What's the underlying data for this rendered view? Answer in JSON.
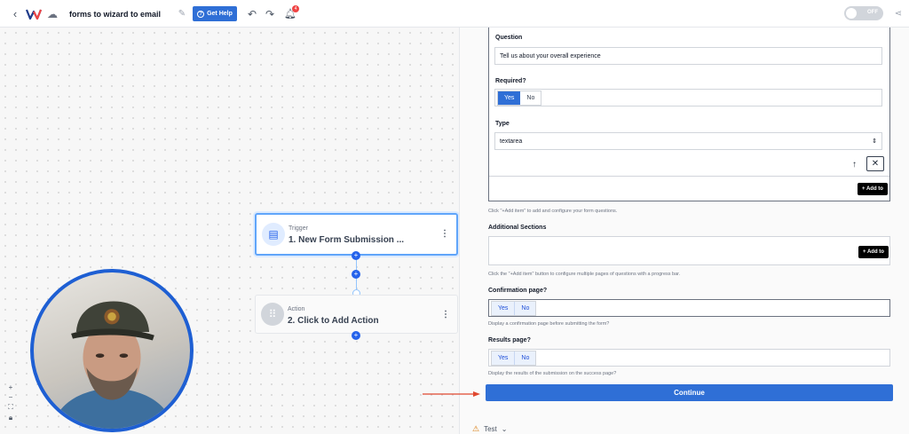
{
  "topbar": {
    "back_icon": "chevron-left-icon",
    "title": "forms to wizard to email",
    "help_label": "Get Help",
    "notification_count": "4",
    "toggle_label": "OFF"
  },
  "canvas": {
    "trigger": {
      "sub": "Trigger",
      "title": "1. New Form Submission ..."
    },
    "action": {
      "sub": "Action",
      "title": "2. Click to Add Action"
    }
  },
  "panel": {
    "question_label": "Question",
    "question_value": "Tell us about your overall experience",
    "required_label": "Required?",
    "yes": "Yes",
    "no": "No",
    "type_label": "Type",
    "type_value": "textarea",
    "add_item_label": "+ Add to",
    "add_item_help": "Click \"+Add item\" to add and configure your form questions.",
    "additional_label": "Additional Sections",
    "additional_help": "Click the \"+Add item\" button to configure multiple pages of questions with a progress bar.",
    "confirmation_label": "Confirmation page?",
    "confirmation_help": "Display a confirmation page before submitting the form?",
    "results_label": "Results page?",
    "results_help": "Display the results of the submission on the success page?",
    "continue_label": "Continue",
    "test_label": "Test"
  },
  "colors": {
    "accent": "#2f6fd6",
    "warning": "#d97706",
    "annotation_arrow": "#e0472f"
  }
}
